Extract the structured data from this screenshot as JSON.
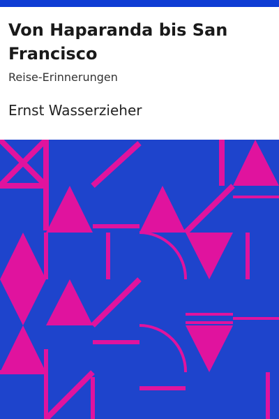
{
  "book": {
    "title": "Von Haparanda bis San Francisco",
    "subtitle": "Reise-Erinnerungen",
    "author": "Ernst Wasserzieher"
  },
  "colors": {
    "top_bar": "#0f3dd4",
    "pattern_bg": "#1e44cc",
    "pattern_fg": "#e0139e"
  }
}
